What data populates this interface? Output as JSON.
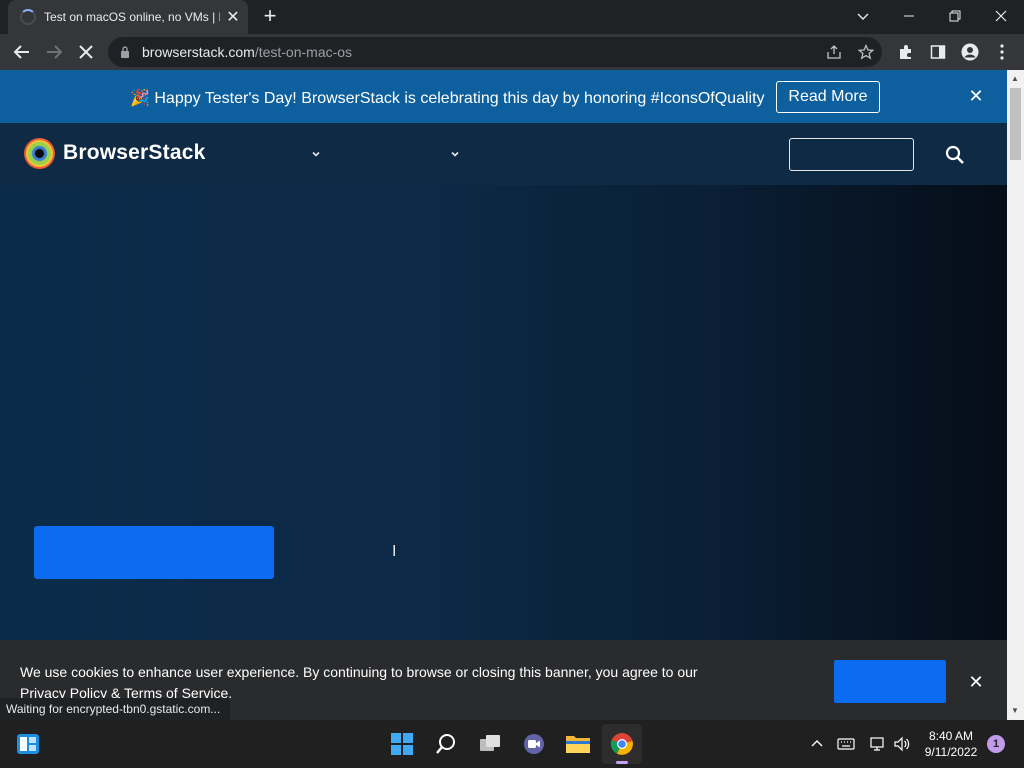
{
  "browser": {
    "tab_title": "Test on macOS online, no VMs | B",
    "new_tab_symbol": "+",
    "url_domain": "browserstack.com",
    "url_path": "/test-on-mac-os",
    "status_text": "Waiting for encrypted-tbn0.gstatic.com..."
  },
  "promo_banner": {
    "emoji": "🎉",
    "text": "Happy Tester's Day! BrowserStack is celebrating this day by honoring #IconsOfQuality",
    "button_label": "Read More",
    "close_symbol": "✕"
  },
  "header": {
    "logo_text": "BrowserStack"
  },
  "cookie_banner": {
    "text": "We use cookies to enhance user experience. By continuing to browse or closing this banner, you agree to our",
    "privacy_link": "Privacy Policy",
    "amp": "&",
    "terms_link": "Terms of Service",
    "period": ".",
    "close_symbol": "✕"
  },
  "taskbar": {
    "time": "8:40 AM",
    "date": "9/11/2022",
    "notification_count": "1"
  },
  "colors": {
    "accent_blue": "#0b6cf1",
    "promo_bg": "#0d5f9e",
    "header_bg": "#0f2a45"
  }
}
